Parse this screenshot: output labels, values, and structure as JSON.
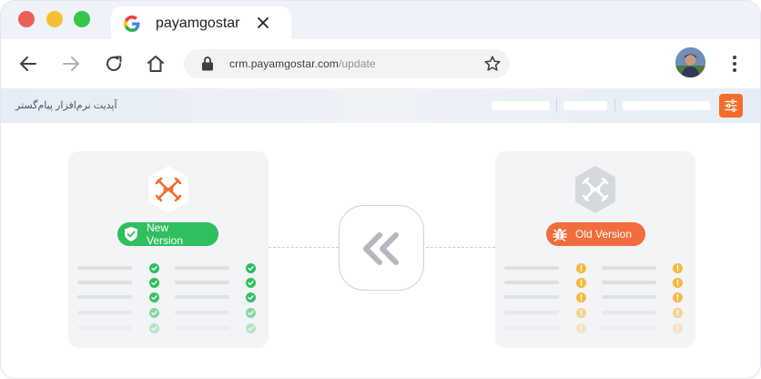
{
  "window": {
    "tab_title": "payamgostar"
  },
  "toolbar": {
    "url_host": "crm.payamgostar.com",
    "url_path": "/update"
  },
  "app_header": {
    "title": "آپدیت نرم‌افزار پیام‌گستر"
  },
  "versions": {
    "new": {
      "label": "New Version",
      "status_color": "#2fbf5e",
      "logo_color": "#f26d2b",
      "icon": "shield-check-icon"
    },
    "old": {
      "label": "Old Version",
      "status_color": "#f26d3d",
      "logo_color": "#b7bcc3",
      "icon": "bug-icon"
    }
  },
  "colors": {
    "accent": "#f26d2b",
    "check": "#2fbf5e",
    "warning": "#f5b93b"
  },
  "icons": {
    "back": "arrow-left-icon",
    "forward": "arrow-right-icon",
    "reload": "reload-icon",
    "home": "home-icon",
    "lock": "lock-icon",
    "bookmark": "star-icon",
    "menu": "kebab-menu-icon",
    "settings": "sliders-icon",
    "transfer": "double-chevron-left-icon"
  }
}
